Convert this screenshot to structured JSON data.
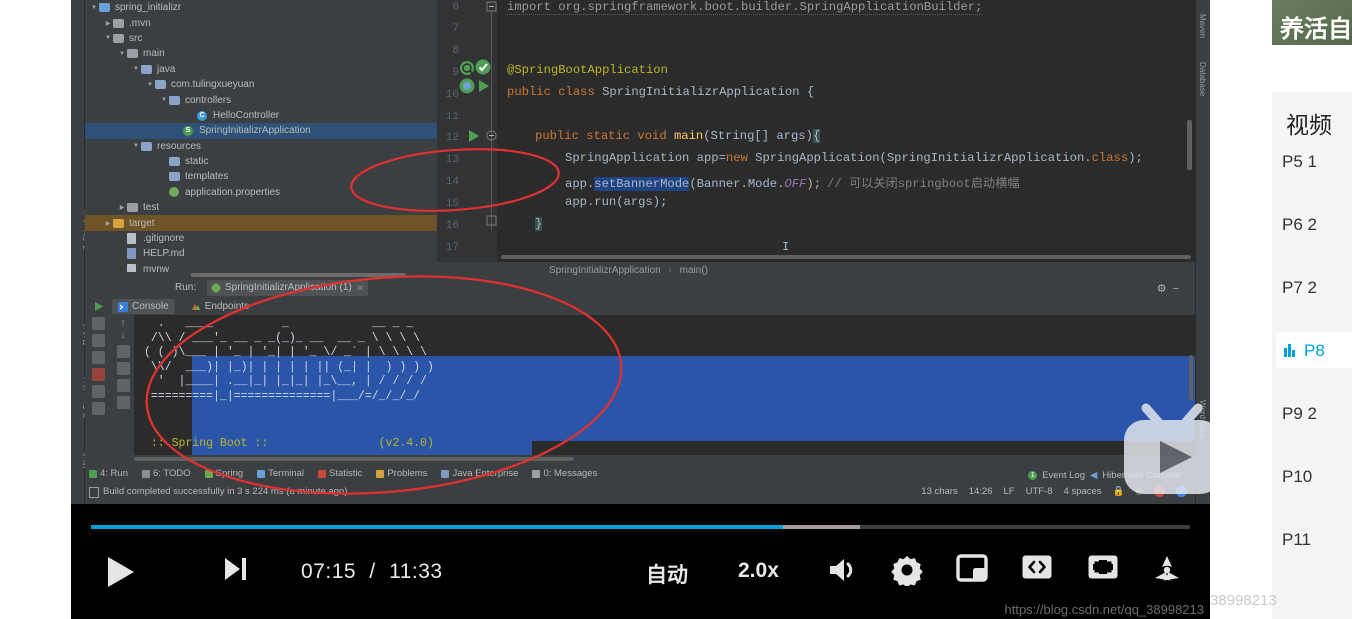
{
  "ide": {
    "left_rail": [
      "7: Structure",
      "Rebel",
      "2: Favorites",
      "Web"
    ],
    "right_rail": [
      "Maven",
      "Database",
      "Word Book"
    ],
    "project_tree": [
      {
        "label": "spring_initializr",
        "indent": 0,
        "arrow": "down",
        "icon": "project-folder-icon",
        "state": "normal"
      },
      {
        "label": ".mvn",
        "indent": 1,
        "arrow": "right",
        "icon": "folder-icon",
        "state": "normal"
      },
      {
        "label": "src",
        "indent": 1,
        "arrow": "down",
        "icon": "folder-icon",
        "state": "normal"
      },
      {
        "label": "main",
        "indent": 2,
        "arrow": "down",
        "icon": "folder-icon",
        "state": "normal"
      },
      {
        "label": "java",
        "indent": 3,
        "arrow": "down",
        "icon": "source-folder-icon",
        "state": "normal"
      },
      {
        "label": "com.tulingxueyuan",
        "indent": 4,
        "arrow": "down",
        "icon": "package-icon",
        "state": "normal"
      },
      {
        "label": "controllers",
        "indent": 5,
        "arrow": "down",
        "icon": "package-icon",
        "state": "normal"
      },
      {
        "label": "HelloController",
        "indent": 7,
        "arrow": "none",
        "icon": "java-class-icon",
        "state": "normal"
      },
      {
        "label": "SpringInitializrApplication",
        "indent": 6,
        "arrow": "none",
        "icon": "spring-class-icon",
        "state": "selected"
      },
      {
        "label": "resources",
        "indent": 3,
        "arrow": "down",
        "icon": "resources-folder-icon",
        "state": "normal"
      },
      {
        "label": "static",
        "indent": 5,
        "arrow": "none",
        "icon": "folder-icon",
        "state": "normal"
      },
      {
        "label": "templates",
        "indent": 5,
        "arrow": "none",
        "icon": "folder-icon",
        "state": "normal"
      },
      {
        "label": "application.properties",
        "indent": 5,
        "arrow": "none",
        "icon": "properties-file-icon",
        "state": "normal"
      },
      {
        "label": "test",
        "indent": 2,
        "arrow": "right",
        "icon": "folder-icon",
        "state": "normal"
      },
      {
        "label": "target",
        "indent": 1,
        "arrow": "right",
        "icon": "target-folder-icon",
        "state": "target"
      },
      {
        "label": ".gitignore",
        "indent": 2,
        "arrow": "none",
        "icon": "file-icon",
        "state": "normal"
      },
      {
        "label": "HELP.md",
        "indent": 2,
        "arrow": "none",
        "icon": "markdown-file-icon",
        "state": "normal"
      },
      {
        "label": "mvnw",
        "indent": 2,
        "arrow": "none",
        "icon": "file-icon",
        "state": "normal"
      }
    ],
    "editor": {
      "line_numbers": [
        "6",
        "7",
        "8",
        "9",
        "10",
        "11",
        "12",
        "13",
        "14",
        "15",
        "16",
        "17"
      ],
      "code": {
        "import": "import org.springframework.boot.builder.SpringApplicationBuilder;",
        "annotation": "@SpringBootApplication",
        "class_kw": "public class",
        "class_name": " SpringInitializrApplication {",
        "main_kw": "public static void ",
        "main_name": "main",
        "main_args": "(String[] args)",
        "main_brace": "{",
        "line13_a": "SpringApplication app=",
        "line13_new": "new",
        "line13_b": " SpringApplication(SpringInitializrApplication.",
        "line13_class": "class",
        "line13_c": ");",
        "line14_a": "app.",
        "line14_sel": "setBannerMode",
        "line14_b": "(Banner.Mode.",
        "line14_off": "OFF",
        "line14_c": ");",
        "line14_comment": "// 可以关闭springboot启动横幅",
        "line15": "app.run(args);",
        "line16": "}"
      },
      "breadcrumb": [
        "SpringInitializrApplication",
        "main()"
      ]
    },
    "run_panel": {
      "run_label": "Run:",
      "config_name": "SpringInitializrApplication (1)",
      "tabs": [
        {
          "label": "Console",
          "icon": "console-icon",
          "active": true
        },
        {
          "label": "Endpoints",
          "icon": "endpoints-icon",
          "active": false
        }
      ],
      "console_banner": [
        "  .   ____          _            __ _ _",
        " /\\\\ / ___'_ __ _ _(_)_ __  __ _ \\ \\ \\ \\",
        "( ( )\\___ | '_ | '_| | '_ \\/ _` | \\ \\ \\ \\",
        " \\\\/  ___)| |_)| | | | | || (_| |  ) ) ) )",
        "  '  |____| .__|_| |_|_| |_\\__, | / / / /",
        " =========|_|==============|___/=/_/_/_/"
      ],
      "spring_boot_line": " :: Spring Boot ::                (v2.4.0)"
    },
    "tool_tabs": [
      {
        "label": "4: Run",
        "icon": "run-icon"
      },
      {
        "label": "6: TODO",
        "icon": "todo-icon"
      },
      {
        "label": "Spring",
        "icon": "spring-icon"
      },
      {
        "label": "Terminal",
        "icon": "terminal-icon"
      },
      {
        "label": "Statistic",
        "icon": "statistic-icon"
      },
      {
        "label": "Problems",
        "icon": "problems-icon"
      },
      {
        "label": "Java Enterprise",
        "icon": "java-enterprise-icon"
      },
      {
        "label": "0: Messages",
        "icon": "messages-icon"
      }
    ],
    "status_bar": {
      "message": "Build completed successfully in 3 s 224 ms (a minute ago)",
      "event_log": "Event Log",
      "hibernate_console": "Hibernate Console",
      "event_count": "1",
      "chars": "13 chars",
      "position": "14:26",
      "line_sep": "LF",
      "encoding": "UTF-8",
      "indent": "4 spaces"
    }
  },
  "player": {
    "current_time": "07:15",
    "separator": "/",
    "total_time": "11:33",
    "progress_percent": 63,
    "buffered_percent": 70,
    "quality_label": "自动",
    "speed_label": "2.0x",
    "buttons": [
      {
        "name": "play-button",
        "icon": "play-icon"
      },
      {
        "name": "next-button",
        "icon": "next-track-icon"
      },
      {
        "name": "volume-button",
        "icon": "volume-icon"
      },
      {
        "name": "settings-button",
        "icon": "gear-icon"
      },
      {
        "name": "pip-button",
        "icon": "picture-in-picture-icon"
      },
      {
        "name": "widescreen-button",
        "icon": "widescreen-icon"
      },
      {
        "name": "fullscreen-button",
        "icon": "fullscreen-icon"
      },
      {
        "name": "danmaku-button",
        "icon": "danmaku-icon"
      }
    ],
    "watermark": "https://blog.csdn.net/qq_38998213",
    "accent_color": "#00a1d6"
  },
  "sidebar": {
    "banner_text": "养活自",
    "playlist_title": "视频",
    "items": [
      {
        "num": "P5",
        "extra": "1",
        "active": false
      },
      {
        "num": "P6",
        "extra": "2",
        "active": false
      },
      {
        "num": "P7",
        "extra": "2",
        "active": false
      },
      {
        "num": "P8",
        "extra": "",
        "active": true
      },
      {
        "num": "P9",
        "extra": "2",
        "active": false
      },
      {
        "num": "P10",
        "extra": "",
        "active": false
      },
      {
        "num": "P11",
        "extra": "",
        "active": false
      }
    ],
    "watermark": "38998213"
  }
}
